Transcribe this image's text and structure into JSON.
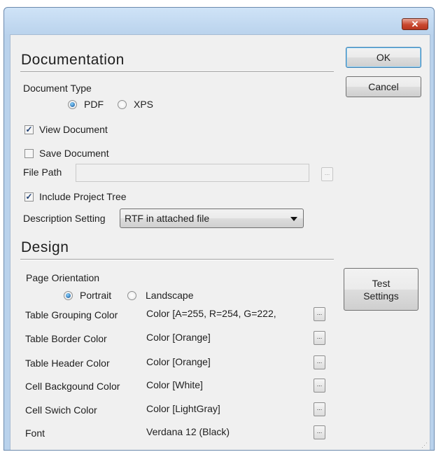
{
  "window": {
    "close_glyph": "✕"
  },
  "documentation": {
    "title": "Documentation",
    "document_type_label": "Document Type",
    "options": [
      "PDF",
      "XPS"
    ],
    "selected": "PDF",
    "view_document": {
      "label": "View Document",
      "checked": true
    },
    "save_document": {
      "label": "Save Document",
      "checked": false
    },
    "file_path": {
      "label": "File Path",
      "value": "",
      "browse": "..."
    },
    "include_project_tree": {
      "label": "Include Project Tree",
      "checked": true
    },
    "description_setting": {
      "label": "Description Setting",
      "value": "RTF in attached file"
    }
  },
  "design": {
    "title": "Design",
    "page_orientation_label": "Page Orientation",
    "orientation_options": [
      "Portrait",
      "Landscape"
    ],
    "selected_orientation": "Portrait",
    "rows": [
      {
        "label": "Table Grouping Color",
        "value": "Color [A=255, R=254, G=222,",
        "button": "..."
      },
      {
        "label": "Table Border Color",
        "value": "Color [Orange]",
        "button": "..."
      },
      {
        "label": "Table Header Color",
        "value": "Color [Orange]",
        "button": "..."
      },
      {
        "label": "Cell Backgound Color",
        "value": "Color [White]",
        "button": "..."
      },
      {
        "label": "Cell Swich Color",
        "value": "Color [LightGray]",
        "button": "..."
      },
      {
        "label": "Font",
        "value": "Verdana 12 (Black)",
        "button": "..."
      }
    ]
  },
  "buttons": {
    "ok": "OK",
    "cancel": "Cancel",
    "test_settings_line1": "Test",
    "test_settings_line2": "Settings"
  },
  "check_glyph": "✓"
}
